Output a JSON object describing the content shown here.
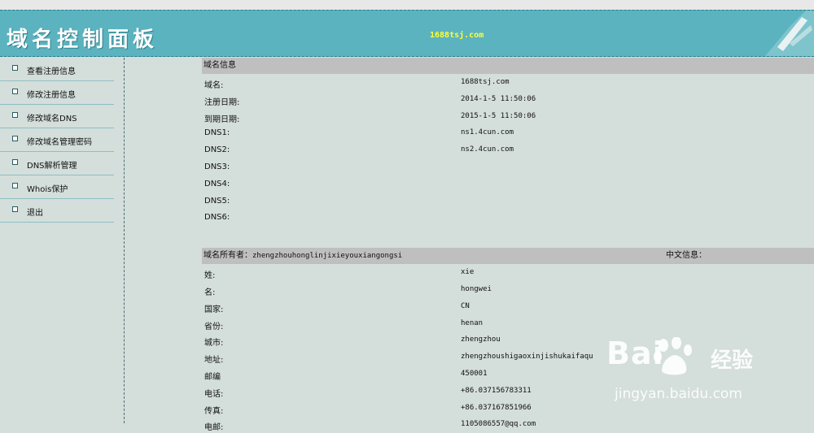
{
  "header": {
    "title": "域名控制面板",
    "domain": "1688tsj.com"
  },
  "sidebar": {
    "items": [
      {
        "label": "查看注册信息"
      },
      {
        "label": "修改注册信息"
      },
      {
        "label": "修改域名DNS"
      },
      {
        "label": "修改域名管理密码"
      },
      {
        "label": "DNS解析管理"
      },
      {
        "label": "Whois保护"
      },
      {
        "label": "退出"
      }
    ]
  },
  "domain_info": {
    "header": "域名信息",
    "rows": [
      {
        "key": "域名:",
        "value": "1688tsj.com"
      },
      {
        "key": "注册日期:",
        "value": "2014-1-5 11:50:06"
      },
      {
        "key": "到期日期:",
        "value": "2015-1-5 11:50:06"
      },
      {
        "key": "DNS1:",
        "value": "ns1.4cun.com"
      },
      {
        "key": "DNS2:",
        "value": "ns2.4cun.com"
      },
      {
        "key": "DNS3:",
        "value": ""
      },
      {
        "key": "DNS4:",
        "value": ""
      },
      {
        "key": "DNS5:",
        "value": ""
      },
      {
        "key": "DNS6:",
        "value": ""
      }
    ]
  },
  "owner_info": {
    "owner_label": "域名所有者：",
    "owner_value": "zhengzhouhonglinjixieyouxiangongsi",
    "cn_info_label": "中文信息：",
    "rows": [
      {
        "key": "姓:",
        "value": "xie"
      },
      {
        "key": "名:",
        "value": "hongwei"
      },
      {
        "key": "国家:",
        "value": "CN"
      },
      {
        "key": "省份:",
        "value": "henan"
      },
      {
        "key": "城市:",
        "value": "zhengzhou"
      },
      {
        "key": "地址:",
        "value": "zhengzhoushigaoxinjishukaifaqu"
      },
      {
        "key": "邮编",
        "value": "450001"
      },
      {
        "key": "电话:",
        "value": "+86.037156783311"
      },
      {
        "key": "传真:",
        "value": "+86.037167851966"
      },
      {
        "key": "电邮:",
        "value": "1105086557@qq.com"
      }
    ]
  },
  "watermark": {
    "logo_text": "Bai",
    "logo_text2": "经验",
    "url": "jingyan.baidu.com"
  }
}
